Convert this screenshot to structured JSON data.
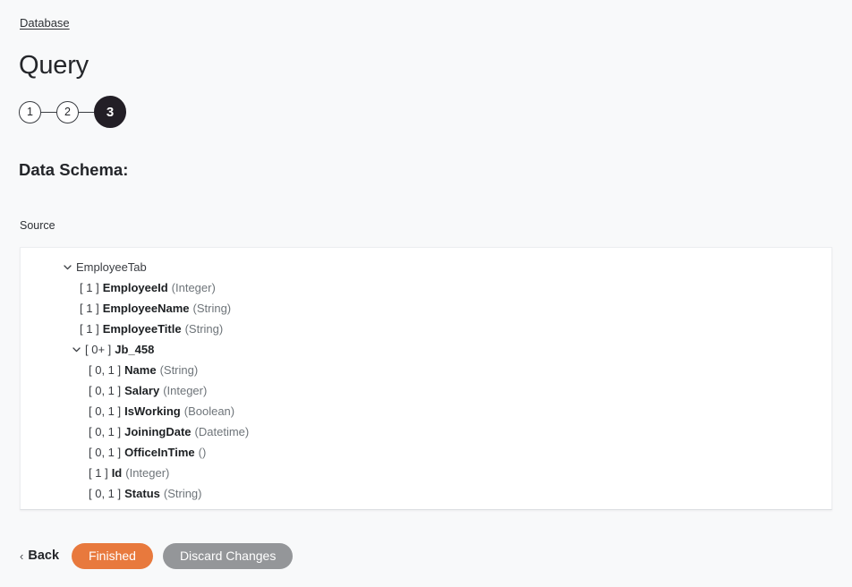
{
  "breadcrumb": {
    "label": "Database"
  },
  "header": {
    "title": "Query"
  },
  "stepper": {
    "steps": [
      {
        "label": "1",
        "active": false
      },
      {
        "label": "2",
        "active": false
      },
      {
        "label": "3",
        "active": true
      }
    ]
  },
  "main": {
    "section_heading": "Data Schema:",
    "source_label": "Source"
  },
  "schema": {
    "rows": [
      {
        "depth": 0,
        "expandable": true,
        "expanded": true,
        "icon": "chevron-down-icon",
        "mult": "",
        "name": "EmployeeTab",
        "type": "",
        "kind": "table"
      },
      {
        "depth": 1,
        "expandable": false,
        "mult": "[ 1 ]",
        "name": "EmployeeId",
        "type": "(Integer)",
        "kind": "field"
      },
      {
        "depth": 1,
        "expandable": false,
        "mult": "[ 1 ]",
        "name": "EmployeeName",
        "type": "(String)",
        "kind": "field"
      },
      {
        "depth": 1,
        "expandable": false,
        "mult": "[ 1 ]",
        "name": "EmployeeTitle",
        "type": "(String)",
        "kind": "field"
      },
      {
        "depth": 1,
        "expandable": true,
        "expanded": true,
        "icon": "chevron-down-icon",
        "mult": "[ 0+ ]",
        "name": "Jb_458",
        "type": "",
        "kind": "group"
      },
      {
        "depth": 2,
        "expandable": false,
        "mult": "[ 0, 1 ]",
        "name": "Name",
        "type": "(String)",
        "kind": "field"
      },
      {
        "depth": 2,
        "expandable": false,
        "mult": "[ 0, 1 ]",
        "name": "Salary",
        "type": "(Integer)",
        "kind": "field"
      },
      {
        "depth": 2,
        "expandable": false,
        "mult": "[ 0, 1 ]",
        "name": "IsWorking",
        "type": "(Boolean)",
        "kind": "field"
      },
      {
        "depth": 2,
        "expandable": false,
        "mult": "[ 0, 1 ]",
        "name": "JoiningDate",
        "type": "(Datetime)",
        "kind": "field"
      },
      {
        "depth": 2,
        "expandable": false,
        "mult": "[ 0, 1 ]",
        "name": "OfficeInTime",
        "type": "()",
        "kind": "field"
      },
      {
        "depth": 2,
        "expandable": false,
        "mult": "[ 1 ]",
        "name": "Id",
        "type": "(Integer)",
        "kind": "field"
      },
      {
        "depth": 2,
        "expandable": false,
        "mult": "[ 0, 1 ]",
        "name": "Status",
        "type": "(String)",
        "kind": "field"
      }
    ]
  },
  "footer": {
    "back_label": "Back",
    "back_chevron": "‹",
    "finished_label": "Finished",
    "discard_label": "Discard Changes"
  },
  "colors": {
    "accent_orange": "#e8793d",
    "neutral_gray": "#949699",
    "active_step": "#231f26",
    "page_bg": "#f8f9fa",
    "panel_bg": "#ffffff"
  }
}
